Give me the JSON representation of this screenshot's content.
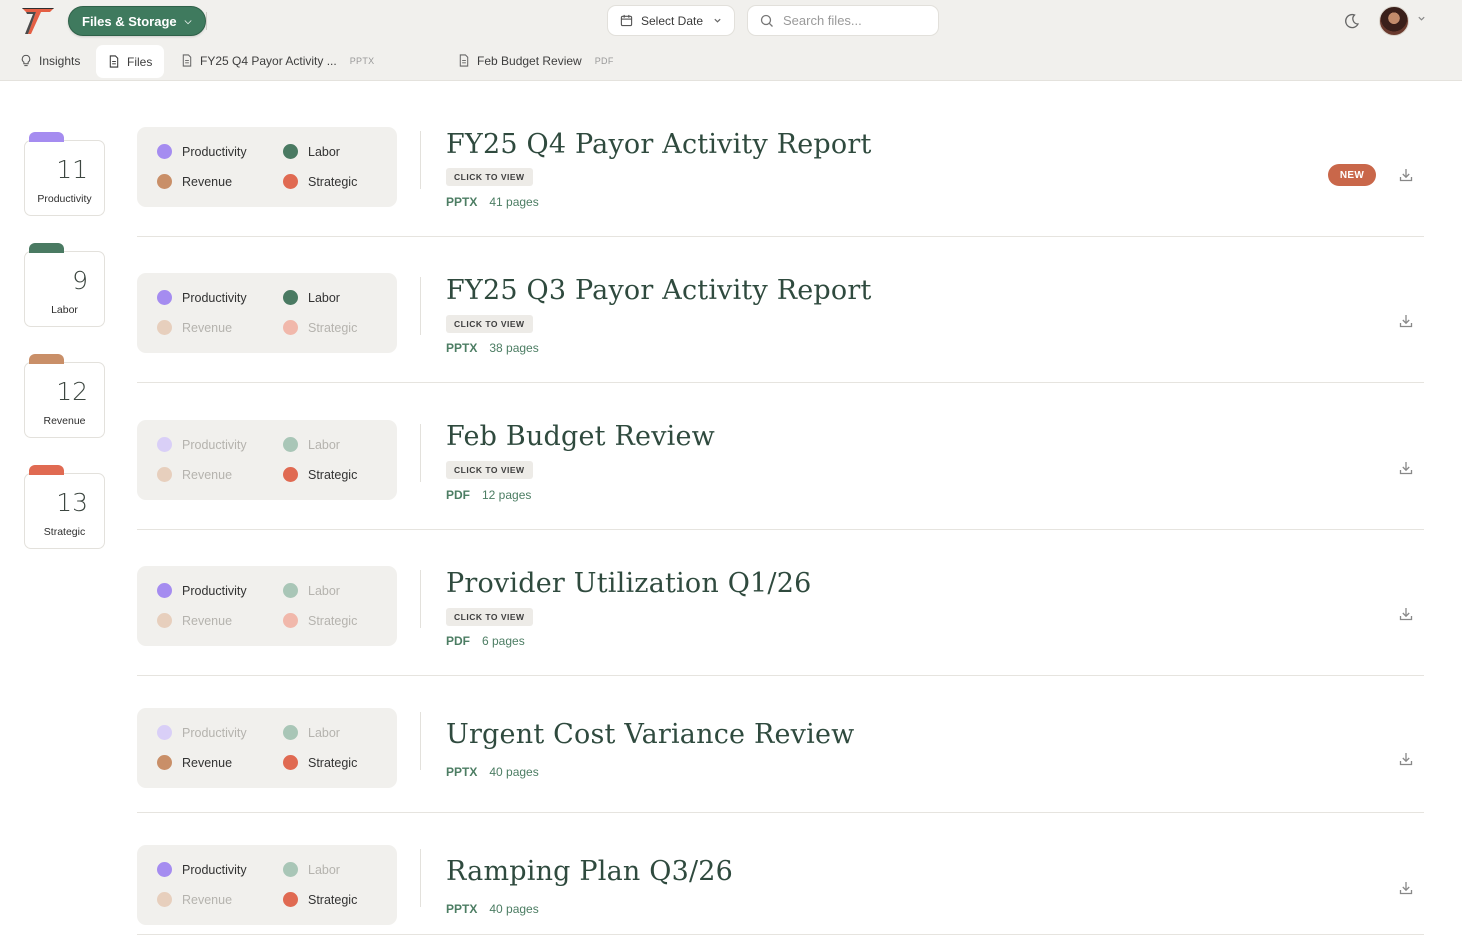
{
  "header": {
    "workspace_label": "Files & Storage",
    "date_label": "Select Date",
    "search_placeholder": "Search files..."
  },
  "tabs": [
    {
      "label": "Insights",
      "icon": "lightbulb-icon"
    },
    {
      "label": "Files",
      "icon": "document-icon"
    },
    {
      "label": "FY25 Q4 Payor Activity ...",
      "type": "PPTX",
      "icon": "document-icon"
    },
    {
      "label": "Feb Budget Review",
      "type": "PDF",
      "icon": "document-icon"
    }
  ],
  "categories": {
    "productivity": {
      "label": "Productivity",
      "color": "#a58cf0",
      "muted": "#d9cff7"
    },
    "labor": {
      "label": "Labor",
      "color": "#4a7a62",
      "muted": "#a9c6b7"
    },
    "revenue": {
      "label": "Revenue",
      "color": "#c98f68",
      "muted": "#e7cfbd"
    },
    "strategic": {
      "label": "Strategic",
      "color": "#e06a52",
      "muted": "#f1b8ab"
    }
  },
  "stats": [
    {
      "count": "11",
      "label": "Productivity",
      "color": "#a58cf0"
    },
    {
      "count": "9",
      "label": "Labor",
      "color": "#4a7a62"
    },
    {
      "count": "12",
      "label": "Revenue",
      "color": "#c98f68"
    },
    {
      "count": "13",
      "label": "Strategic",
      "color": "#e06a52"
    }
  ],
  "files": [
    {
      "title": "FY25 Q4 Payor Activity Report",
      "view_label": "CLICK TO VIEW",
      "type": "PPTX",
      "pages": "41 pages",
      "badge": "NEW",
      "tags": {
        "productivity": true,
        "labor": true,
        "revenue": true,
        "strategic": true
      }
    },
    {
      "title": "FY25 Q3 Payor Activity Report",
      "view_label": "CLICK TO VIEW",
      "type": "PPTX",
      "pages": "38 pages",
      "tags": {
        "productivity": true,
        "labor": true,
        "revenue": false,
        "strategic": false
      }
    },
    {
      "title": "Feb Budget Review",
      "view_label": "CLICK TO VIEW",
      "type": "PDF",
      "pages": "12 pages",
      "tags": {
        "productivity": false,
        "labor": false,
        "revenue": false,
        "strategic": true
      }
    },
    {
      "title": "Provider Utilization Q1/26",
      "view_label": "CLICK TO VIEW",
      "type": "PDF",
      "pages": "6 pages",
      "tags": {
        "productivity": true,
        "labor": false,
        "revenue": false,
        "strategic": false
      }
    },
    {
      "title": "Urgent Cost Variance Review",
      "type": "PPTX",
      "pages": "40 pages",
      "tags": {
        "productivity": false,
        "labor": false,
        "revenue": true,
        "strategic": true
      }
    },
    {
      "title": "Ramping Plan Q3/26",
      "type": "PPTX",
      "pages": "40 pages",
      "tags": {
        "productivity": true,
        "labor": false,
        "revenue": false,
        "strategic": true
      }
    }
  ]
}
